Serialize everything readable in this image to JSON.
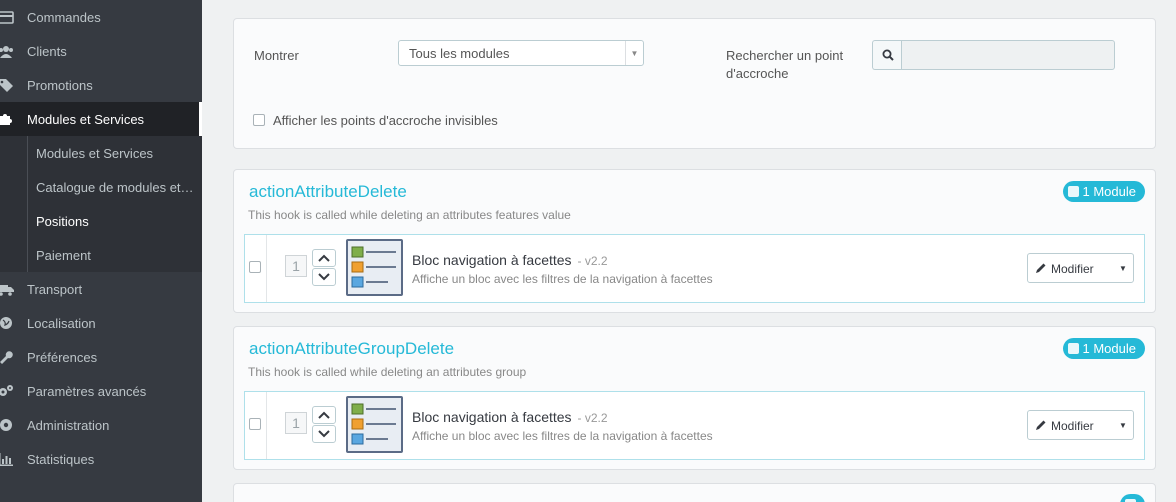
{
  "sidebar": {
    "items": [
      {
        "label": "Commandes",
        "icon": "cart-icon"
      },
      {
        "label": "Clients",
        "icon": "users-icon"
      },
      {
        "label": "Promotions",
        "icon": "tag-icon"
      },
      {
        "label": "Modules et Services",
        "icon": "puzzle-icon"
      },
      {
        "label": "Transport",
        "icon": "truck-icon"
      },
      {
        "label": "Localisation",
        "icon": "globe-icon"
      },
      {
        "label": "Préférences",
        "icon": "wrench-icon"
      },
      {
        "label": "Paramètres avancés",
        "icon": "cogs-icon"
      },
      {
        "label": "Administration",
        "icon": "gear-icon"
      },
      {
        "label": "Statistiques",
        "icon": "bar-chart-icon"
      }
    ],
    "sub_items": [
      {
        "label": "Modules et Services"
      },
      {
        "label": "Catalogue de modules et t..."
      },
      {
        "label": "Positions"
      },
      {
        "label": "Paiement"
      }
    ]
  },
  "filters": {
    "show_label": "Montrer",
    "show_value": "Tous les modules",
    "search_label": "Rechercher un point d'accroche",
    "search_value": "",
    "invisible_label": "Afficher les points d'accroche invisibles"
  },
  "hooks": [
    {
      "title": "actionAttributeDelete",
      "description": "This hook is called while deleting an attributes features value",
      "badge": "1 Module",
      "module": {
        "position": "1",
        "name": "Bloc navigation à facettes",
        "version": "- v2.2",
        "description": "Affiche un bloc avec les filtres de la navigation à facettes",
        "action_label": "Modifier"
      }
    },
    {
      "title": "actionAttributeGroupDelete",
      "description": "This hook is called while deleting an attributes group",
      "badge": "1 Module",
      "module": {
        "position": "1",
        "name": "Bloc navigation à facettes",
        "version": "- v2.2",
        "description": "Affiche un bloc avec les filtres de la navigation à facettes",
        "action_label": "Modifier"
      }
    }
  ],
  "colors": {
    "accent": "#25b9d7",
    "sidebar_bg": "#363a41",
    "sidebar_active": "#202226"
  }
}
